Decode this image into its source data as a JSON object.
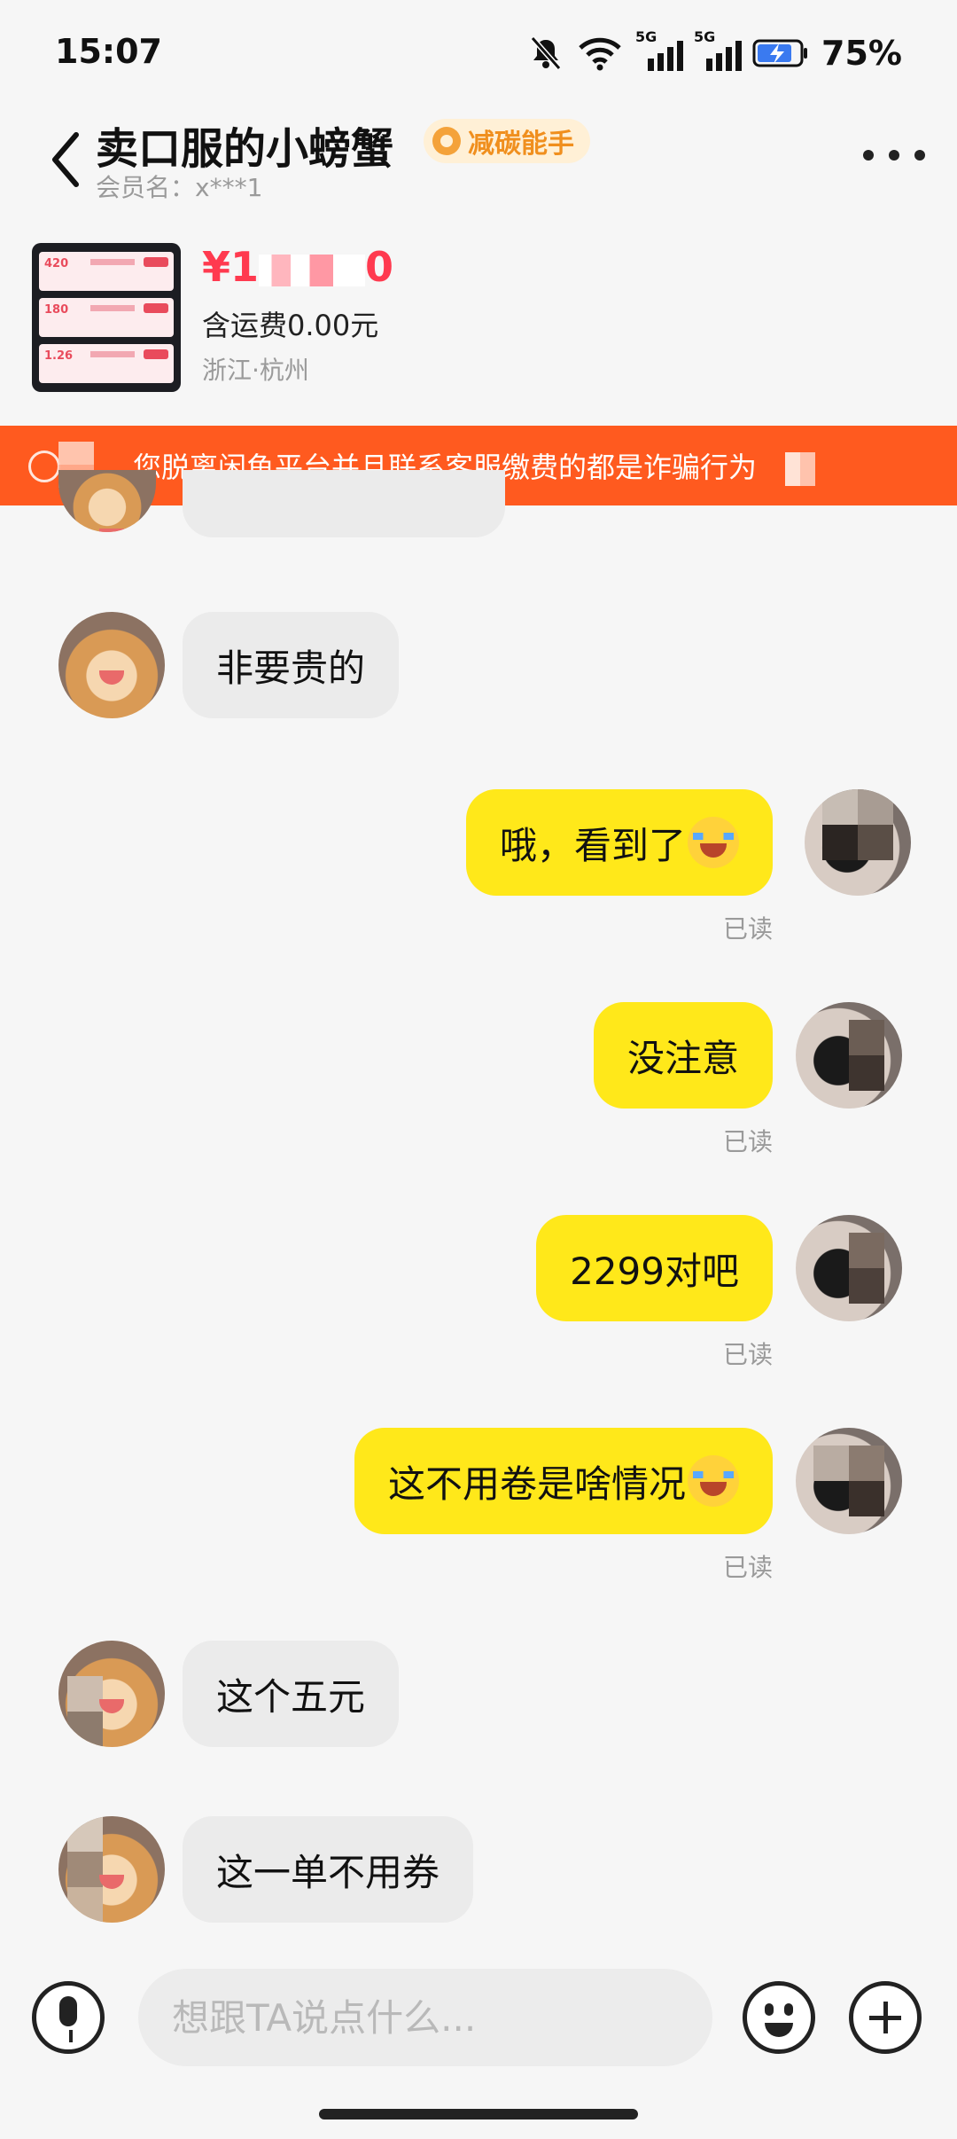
{
  "status_bar": {
    "time": "15:07",
    "network_1": "5G",
    "network_2": "5G",
    "battery": "75%"
  },
  "header": {
    "title": "卖口服的小螃蟹",
    "badge": "减碳能手",
    "member": "会员名：x***1"
  },
  "product": {
    "price": "¥1",
    "price_tail": "0",
    "shipping": "含运费0.00元",
    "location": "浙江·杭州"
  },
  "warning": {
    "text": "您脱离闲鱼平台并且联系客服缴费的都是诈骗行为"
  },
  "messages": [
    {
      "from": "seller",
      "text": "非要贵的"
    },
    {
      "from": "me",
      "text": "哦，看到了",
      "status": "已读"
    },
    {
      "from": "me",
      "text": "没注意",
      "status": "已读"
    },
    {
      "from": "me",
      "text": "2299对吧",
      "status": "已读"
    },
    {
      "from": "me",
      "text": "这不用卷是啥情况",
      "status": "已读"
    },
    {
      "from": "seller",
      "text": "这个五元"
    },
    {
      "from": "seller",
      "text": "这一单不用券"
    }
  ],
  "input": {
    "placeholder": "想跟TA说点什么..."
  },
  "colors": {
    "accent_yellow": "#ffe81a",
    "warning_orange": "#ff5a1f",
    "price_red": "#ff3a4f",
    "badge_orange": "#f08f1e"
  },
  "icons": [
    "back-icon",
    "more-icon",
    "mute-icon",
    "wifi-icon",
    "battery-icon",
    "mic-icon",
    "emoji-icon",
    "plus-icon",
    "info-icon"
  ]
}
